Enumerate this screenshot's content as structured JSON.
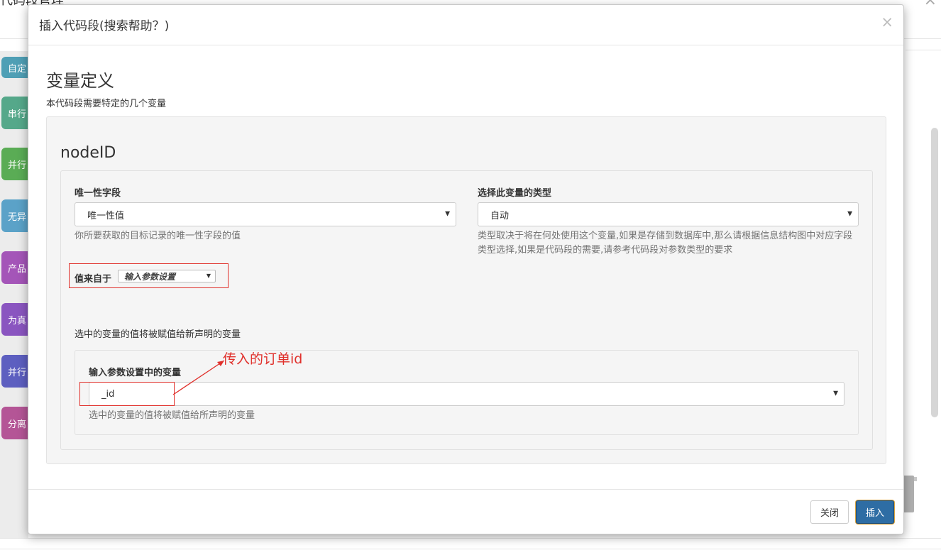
{
  "background": {
    "title": "代码段管理",
    "blocks": [
      {
        "label": "自定",
        "color": "#4f9fb5"
      },
      {
        "label": "串行",
        "color": "#55a88a"
      },
      {
        "label": "并行",
        "color": "#5aac55"
      },
      {
        "label": "无异",
        "color": "#5ba2c8"
      },
      {
        "label": "产品",
        "color": "#a455b8"
      },
      {
        "label": "为真",
        "color": "#8a55c0"
      },
      {
        "label": "并行",
        "color": "#5d5fc0"
      },
      {
        "label": "分离",
        "color": "#b45596"
      }
    ]
  },
  "modal": {
    "title": "插入代码段(搜索帮助？)",
    "close_symbol": "×",
    "section_heading": "变量定义",
    "section_desc": "本代码段需要特定的几个变量",
    "variable": {
      "name": "nodeID",
      "unique_field": {
        "label": "唯一性字段",
        "value": "唯一性值",
        "help": "你所要获取的目标记录的唯一性字段的值"
      },
      "var_type": {
        "label": "选择此变量的类型",
        "value": "自动",
        "help": "类型取决于将在何处使用这个变量,如果是存储到数据库中,那么请根据信息结构图中对应字段类型选择,如果是代码段的需要,请参考代码段对参数类型的要求"
      },
      "value_from": {
        "label": "值来自于",
        "value": "输入参数设置"
      },
      "assign_note": "选中的变量的值将被赋值给新声明的变量",
      "input_param": {
        "label": "输入参数设置中的变量",
        "value": "_id",
        "help": "选中的变量的值将被赋值给所声明的变量"
      }
    },
    "annotation": "传入的订单id",
    "buttons": {
      "close": "关闭",
      "insert": "插入"
    }
  },
  "colors": {
    "primary": "#2e6da4",
    "annotation_red": "#e0302b"
  }
}
